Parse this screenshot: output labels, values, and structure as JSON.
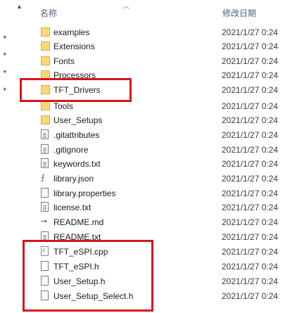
{
  "header": {
    "name_col": "名称",
    "date_col": "修改日期"
  },
  "rows": [
    {
      "name": "examples",
      "date": "2021/1/27 0:24",
      "icon": "folder-icon"
    },
    {
      "name": "Extensions",
      "date": "2021/1/27 0:24",
      "icon": "folder-icon"
    },
    {
      "name": "Fonts",
      "date": "2021/1/27 0:24",
      "icon": "folder-icon"
    },
    {
      "name": "Processors",
      "date": "2021/1/27 0:24",
      "icon": "folder-icon"
    },
    {
      "name": "TFT_Drivers",
      "date": "2021/1/27 0:24",
      "icon": "folder-icon"
    },
    {
      "name": "Tools",
      "date": "2021/1/27 0:24",
      "icon": "folder-icon"
    },
    {
      "name": "User_Setups",
      "date": "2021/1/27 0:24",
      "icon": "folder-icon"
    },
    {
      "name": ".gitattributes",
      "date": "2021/1/27 0:24",
      "icon": "file-icon"
    },
    {
      "name": ".gitignore",
      "date": "2021/1/27 0:24",
      "icon": "file-icon"
    },
    {
      "name": "keywords.txt",
      "date": "2021/1/27 0:24",
      "icon": "text-file-icon"
    },
    {
      "name": "library.json",
      "date": "2021/1/27 0:24",
      "icon": "json-file-icon"
    },
    {
      "name": "library.properties",
      "date": "2021/1/27 0:24",
      "icon": "file-icon"
    },
    {
      "name": "license.txt",
      "date": "2021/1/27 0:24",
      "icon": "text-file-icon"
    },
    {
      "name": "README.md",
      "date": "2021/1/27 0:24",
      "icon": "markdown-file-icon"
    },
    {
      "name": "README.txt",
      "date": "2021/1/27 0:24",
      "icon": "text-file-icon"
    },
    {
      "name": "TFT_eSPI.cpp",
      "date": "2021/1/27 0:24",
      "icon": "cpp-file-icon"
    },
    {
      "name": "TFT_eSPI.h",
      "date": "2021/1/27 0:24",
      "icon": "file-icon"
    },
    {
      "name": "User_Setup.h",
      "date": "2021/1/27 0:24",
      "icon": "file-icon"
    },
    {
      "name": "User_Setup_Select.h",
      "date": "2021/1/27 0:24",
      "icon": "file-icon"
    }
  ],
  "colors": {
    "highlight": "#d8141b",
    "folder": "#f8d775",
    "header_text": "#4c607a"
  }
}
